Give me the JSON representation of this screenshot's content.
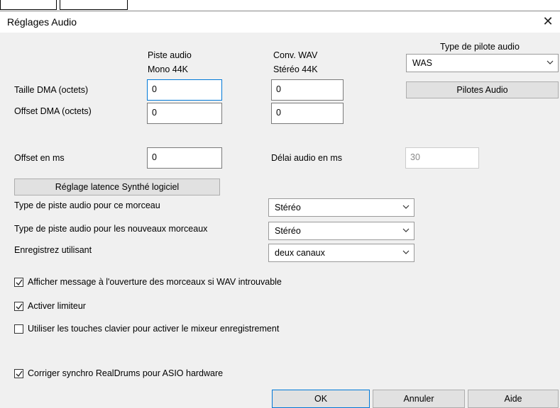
{
  "window": {
    "title": "Réglages Audio",
    "close_glyph": "✕"
  },
  "columns": {
    "piste_line1": "Piste audio",
    "piste_line2": "Mono 44K",
    "conv_line1": "Conv. WAV",
    "conv_line2": "Stéréo 44K"
  },
  "driver": {
    "label": "Type de pilote audio",
    "value": "WAS",
    "button": "Pilotes Audio"
  },
  "dma": {
    "size_label": "Taille DMA (octets)",
    "size_piste": "0",
    "size_conv": "0",
    "offset_label": "Offset DMA (octets)",
    "offset_piste": "0",
    "offset_conv": "0"
  },
  "offset_ms": {
    "label": "Offset en ms",
    "value": "0"
  },
  "delai": {
    "label": "Délai audio en ms",
    "value": "30"
  },
  "latency_button": "Réglage latence Synthé logiciel",
  "track_type_song": {
    "label": "Type de piste audio pour ce morceau",
    "value": "Stéréo"
  },
  "track_type_new": {
    "label": "Type de piste audio pour les nouveaux morceaux",
    "value": "Stéréo"
  },
  "record_using": {
    "label": "Enregistrez utilisant",
    "value": "deux canaux"
  },
  "checkboxes": [
    {
      "label": "Afficher message à l'ouverture des morceaux si WAV introuvable",
      "checked": true
    },
    {
      "label": "Activer limiteur",
      "checked": true
    },
    {
      "label": "Utiliser les touches clavier pour activer le mixeur enregistrement",
      "checked": false
    },
    {
      "label": "Corriger synchro RealDrums pour ASIO hardware",
      "checked": true
    }
  ],
  "buttons": {
    "ok": "OK",
    "cancel": "Annuler",
    "help": "Aide"
  },
  "colors": {
    "dialog_bg": "#f0f0f0",
    "focus_border": "#0078d7",
    "button_bg": "#e1e1e1"
  }
}
